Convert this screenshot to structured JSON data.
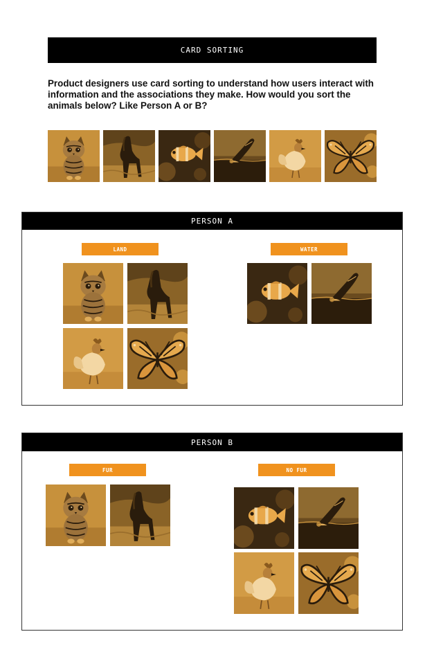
{
  "header": {
    "title": "CARD SORTING"
  },
  "intro": {
    "text": "Product designers use card sorting to understand how users interact with information and the associations they make. How would you sort the animals below? Like Person A or B?"
  },
  "animals": [
    {
      "name": "kitten",
      "icon": "kitten-icon"
    },
    {
      "name": "horse",
      "icon": "horse-icon"
    },
    {
      "name": "clownfish",
      "icon": "clownfish-icon"
    },
    {
      "name": "whale",
      "icon": "whale-icon"
    },
    {
      "name": "rooster",
      "icon": "rooster-icon"
    },
    {
      "name": "butterfly",
      "icon": "butterfly-icon"
    }
  ],
  "person_a": {
    "title": "PERSON A",
    "groups": [
      {
        "label": "LAND",
        "animals": [
          "kitten",
          "horse",
          "rooster",
          "butterfly"
        ]
      },
      {
        "label": "WATER",
        "animals": [
          "clownfish",
          "whale"
        ]
      }
    ]
  },
  "person_b": {
    "title": "PERSON B",
    "groups": [
      {
        "label": "FUR",
        "animals": [
          "kitten",
          "horse"
        ]
      },
      {
        "label": "NO FUR",
        "animals": [
          "clownfish",
          "whale",
          "rooster",
          "butterfly"
        ]
      }
    ]
  },
  "colors": {
    "accent": "#f0921e",
    "card_tint": "#c08a38",
    "header_bg": "#000000"
  }
}
